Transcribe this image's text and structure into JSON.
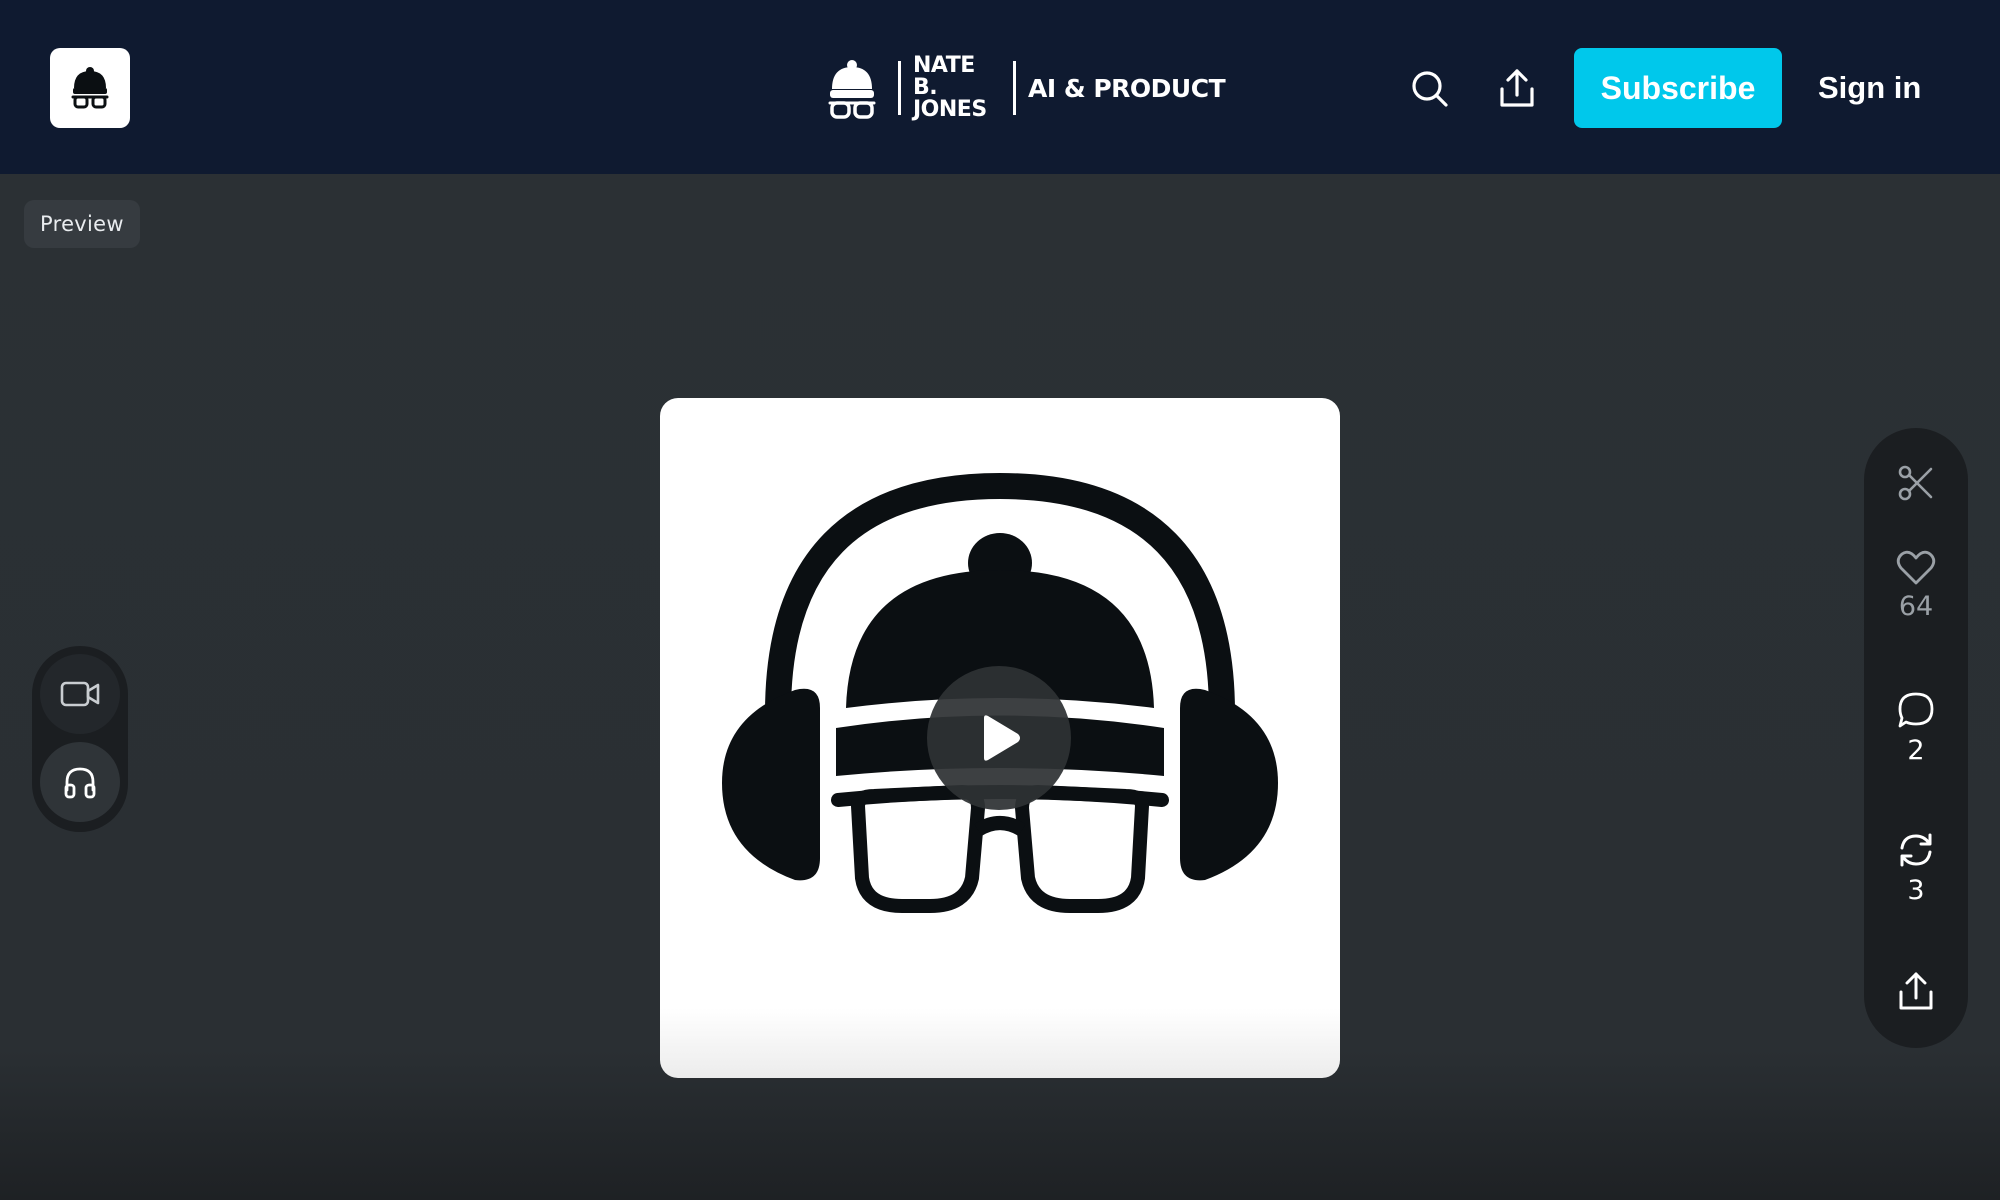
{
  "header": {
    "brand_name_line1": "NATE B.",
    "brand_name_line2": "JONES",
    "brand_tagline": "AI & PRODUCT",
    "subscribe_label": "Subscribe",
    "signin_label": "Sign in",
    "icons": [
      "app-logo-icon",
      "search-icon",
      "share-icon"
    ]
  },
  "preview_label": "Preview",
  "media_switch": {
    "options": [
      "video-icon",
      "headphones-icon"
    ],
    "selected": "headphones-icon"
  },
  "actions": {
    "like_count": "64",
    "comment_count": "2",
    "restack_count": "3",
    "icons": [
      "scissors-icon",
      "heart-icon",
      "comment-icon",
      "restack-icon",
      "share-icon"
    ]
  },
  "colors": {
    "header_bg": "#0f1a30",
    "page_bg": "#2b3034",
    "accent": "#00c8eb",
    "rail_bg": "#1b1e21",
    "logo_dark": "#0b0f12"
  }
}
